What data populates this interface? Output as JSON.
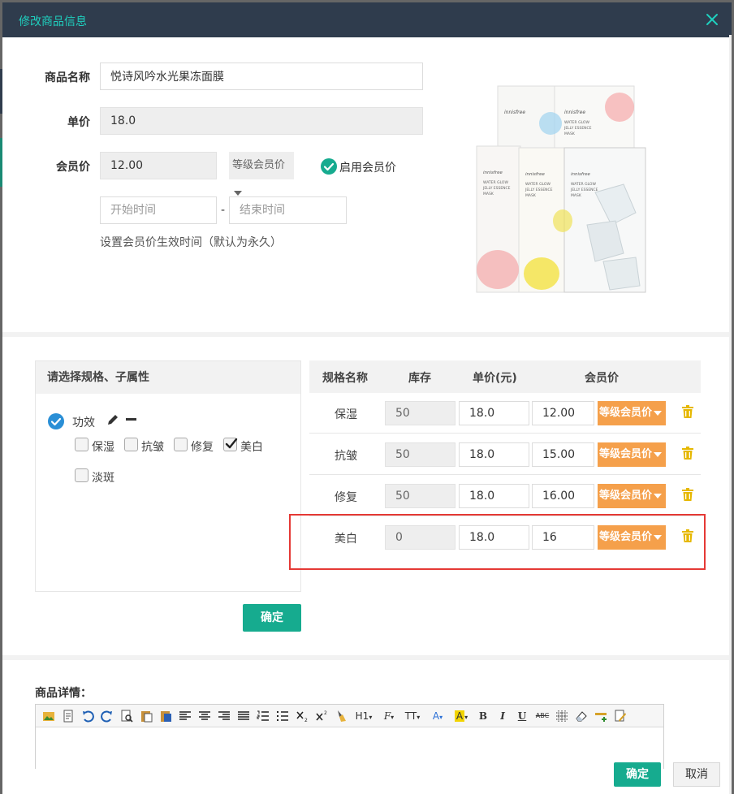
{
  "dialog": {
    "title": "修改商品信息"
  },
  "form": {
    "name_label": "商品名称",
    "name_value": "悦诗风吟水光果冻面膜",
    "price_label": "单价",
    "price_value": "18.0",
    "member_label": "会员价",
    "member_value": "12.00",
    "level_select": "等级会员价",
    "enable_member_label": "启用会员价",
    "start_placeholder": "开始时间",
    "end_placeholder": "结束时间",
    "date_separator": "-",
    "validity_hint": "设置会员价生效时间（默认为永久）"
  },
  "product_image": {
    "brand": "innisfree",
    "lines": [
      "WATER GLOW",
      "JELLY ESSENCE",
      "MASK"
    ]
  },
  "spec": {
    "header": "请选择规格、子属性",
    "group_name": "功效",
    "options": [
      {
        "label": "保湿",
        "checked": false
      },
      {
        "label": "抗皱",
        "checked": false
      },
      {
        "label": "修复",
        "checked": false
      },
      {
        "label": "美白",
        "checked": true
      },
      {
        "label": "淡斑",
        "checked": false
      }
    ],
    "confirm_label": "确定"
  },
  "table": {
    "headers": [
      "规格名称",
      "库存",
      "单价(元)",
      "会员价"
    ],
    "level_button": "等级会员价",
    "rows": [
      {
        "name": "保湿",
        "stock": "50",
        "price": "18.0",
        "member": "12.00"
      },
      {
        "name": "抗皱",
        "stock": "50",
        "price": "18.0",
        "member": "15.00"
      },
      {
        "name": "修复",
        "stock": "50",
        "price": "18.0",
        "member": "16.00"
      },
      {
        "name": "美白",
        "stock": "0",
        "price": "18.0",
        "member": "16"
      }
    ]
  },
  "details": {
    "label": "商品详情：",
    "toolbar_text": {
      "heading": "H1",
      "font": "F",
      "size": "TT",
      "font_color": "A",
      "bg_color": "A",
      "bold": "B",
      "italic": "I",
      "underline": "U",
      "abc": "ABC"
    }
  },
  "footer": {
    "ok_label": "确定",
    "cancel_label": "取消"
  },
  "colors": {
    "accent": "#16ab8f",
    "title_bar": "#2f3c4d",
    "title_text": "#1fcfbe",
    "orange": "#f5a04b",
    "highlight": "#e53935",
    "check_blue": "#2a8fd6"
  }
}
